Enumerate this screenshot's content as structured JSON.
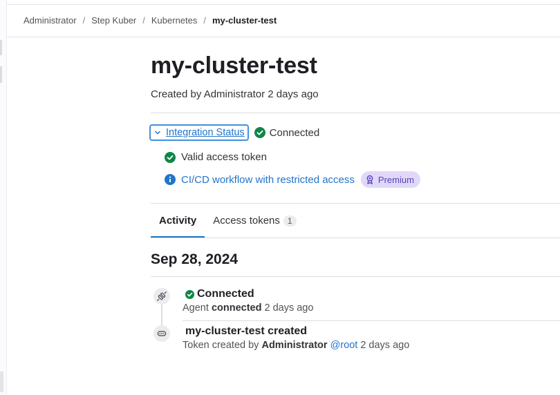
{
  "breadcrumb": {
    "items": [
      "Administrator",
      "Step Kuber",
      "Kubernetes"
    ],
    "separator": "/",
    "current": "my-cluster-test"
  },
  "header": {
    "title": "my-cluster-test",
    "subtitle": "Created by Administrator 2 days ago"
  },
  "integration": {
    "toggle_label": "Integration Status",
    "status": "Connected",
    "checks": [
      {
        "label": "Valid access token",
        "icon": "check-circle-icon",
        "color": "#108548"
      },
      {
        "label": "CI/CD workflow with restricted access",
        "icon": "information-icon",
        "color": "#1f75cb",
        "badge": "Premium"
      }
    ]
  },
  "tabs": [
    {
      "label": "Activity",
      "active": true
    },
    {
      "label": "Access tokens",
      "count": "1",
      "active": false
    }
  ],
  "activity": {
    "date": "Sep 28, 2024",
    "events": [
      {
        "icon": "connection-icon",
        "title": "Connected",
        "status_icon": "check-circle-icon",
        "desc_prefix": "Agent",
        "desc_bold": "connected",
        "desc_suffix": "2 days ago"
      },
      {
        "icon": "token-icon",
        "title": "my-cluster-test created",
        "desc_prefix": "Token created by",
        "desc_bold": "Administrator",
        "desc_link": "@root",
        "desc_suffix": "2 days ago"
      }
    ]
  },
  "colors": {
    "link": "#1f75cb",
    "success": "#108548",
    "premium_bg": "#e1d8f9",
    "premium_text": "#5943b6",
    "focus_ring": "#428fdc"
  }
}
